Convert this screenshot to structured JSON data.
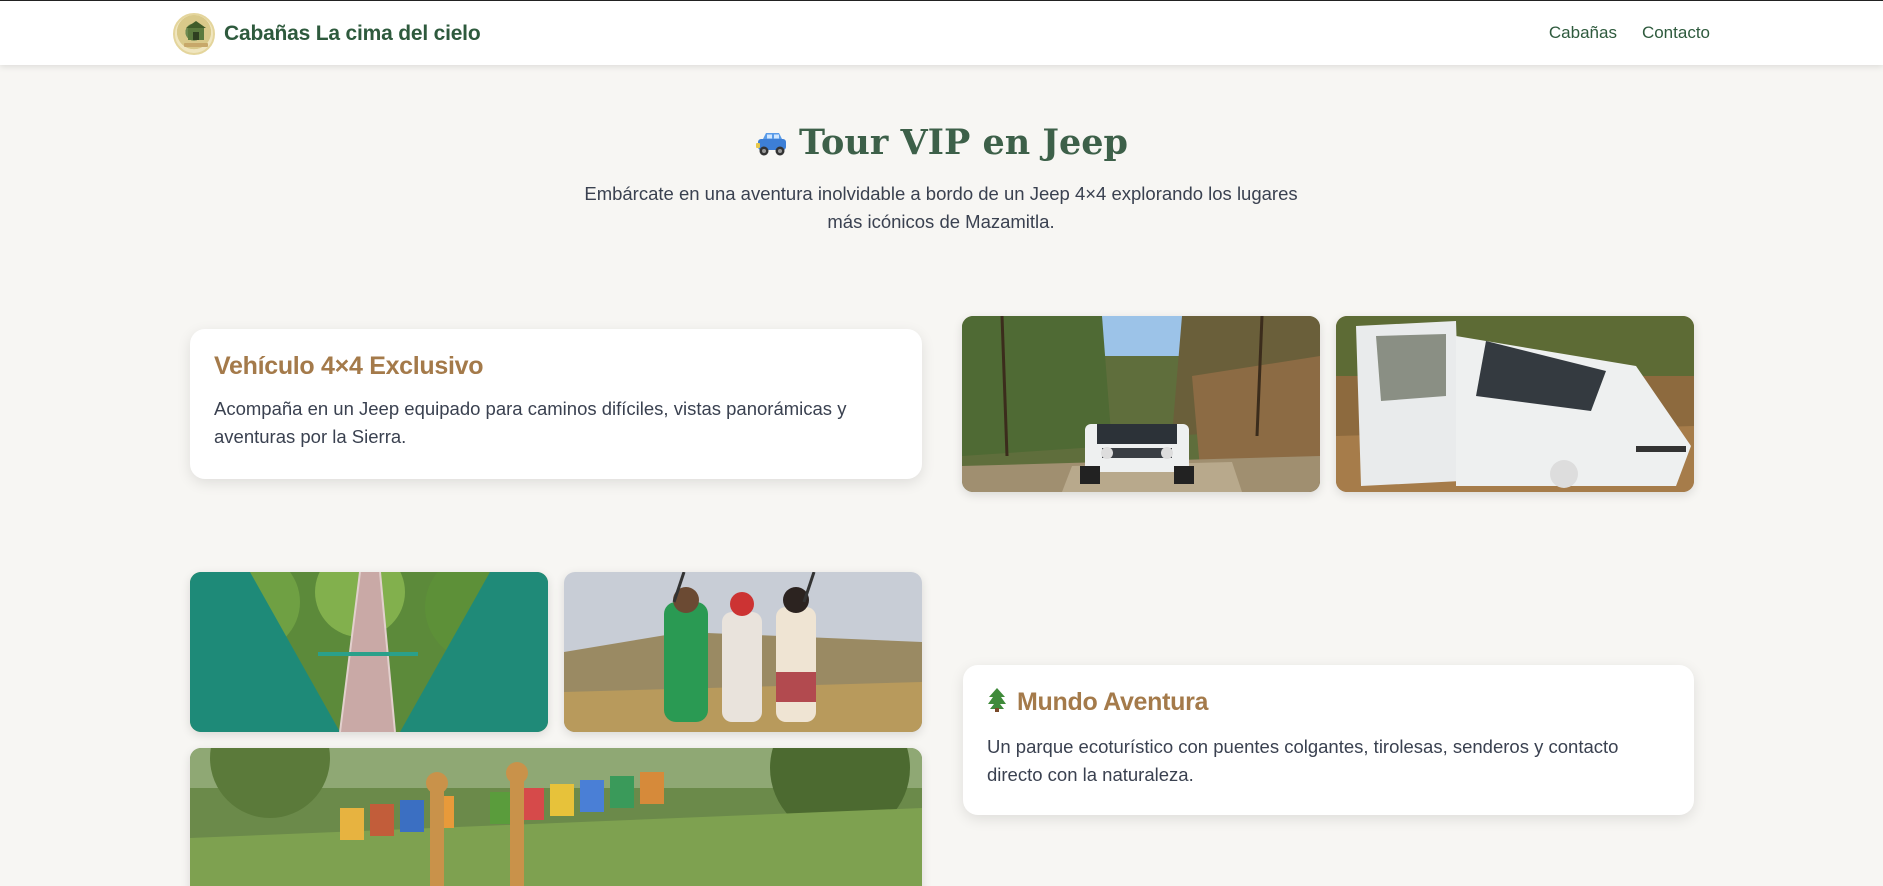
{
  "navbar": {
    "brand_name": "Cabañas La cima del cielo",
    "links": [
      {
        "label": "Cabañas"
      },
      {
        "label": "Contacto"
      }
    ]
  },
  "hero": {
    "icon": "jeep-icon",
    "title": "Tour VIP en Jeep",
    "subtitle": "Embárcate en una aventura inolvidable a bordo de un Jeep 4×4 explorando los lugares más icónicos de Mazamitla."
  },
  "sections": [
    {
      "title": "Vehículo 4×4 Exclusivo",
      "text": "Acompaña en un Jeep equipado para caminos difíciles, vistas panorámicas y aventuras por la Sierra."
    },
    {
      "icon": "pine-tree-icon",
      "title": "Mundo Aventura",
      "text": "Un parque ecoturístico con puentes colgantes, tirolesas, senderos y contacto directo con la naturaleza."
    }
  ],
  "colors": {
    "brand_green": "#2e5a3d",
    "accent_brown": "#a47a4a",
    "background": "#f7f6f3"
  }
}
